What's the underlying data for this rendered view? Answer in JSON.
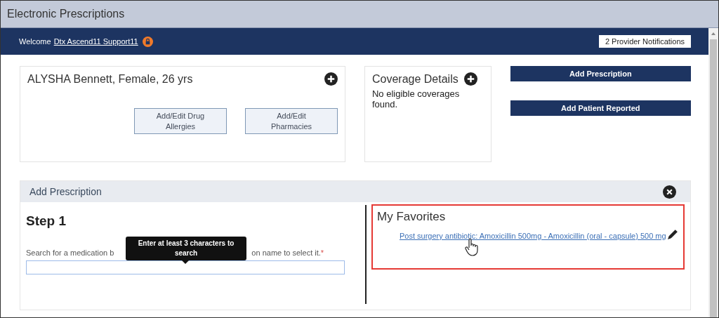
{
  "window": {
    "title": "Electronic Prescriptions"
  },
  "nav": {
    "welcome": "Welcome",
    "user_link": "Dtx Ascend11 Support11",
    "notifications": "2 Provider Notifications"
  },
  "patient_card": {
    "title": "ALYSHA Bennett, Female, 26 yrs",
    "buttons": [
      "Add/Edit Drug Allergies",
      "Add/Edit Pharmacies"
    ]
  },
  "coverage_card": {
    "title": "Coverage Details",
    "message": "No eligible coverages found."
  },
  "actions": [
    "Add Prescription",
    "Add Patient Reported"
  ],
  "add_prescription": {
    "title": "Add Prescription",
    "step": "Step 1",
    "label_start": "Search for a medication b",
    "label_end": "on name to select it.",
    "required_mark": "*",
    "tooltip": "Enter at least 3 characters to search",
    "favorites": {
      "title": "My Favorites",
      "highlighted": true,
      "items": [
        {
          "label": "Post surgery antibiotic: Amoxicillin 500mg - Amoxicillin (oral - capsule) 500 mg",
          "editable": true
        }
      ]
    }
  }
}
